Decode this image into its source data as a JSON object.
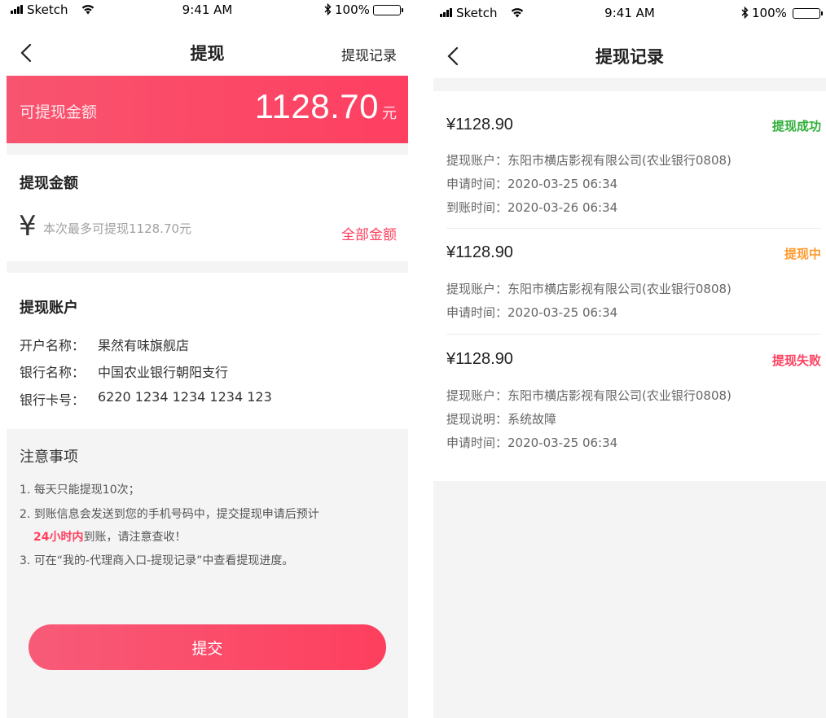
{
  "status_bar": {
    "carrier": "Sketch",
    "time": "9:41 AM",
    "battery": "100%"
  },
  "withdraw_page": {
    "title": "提现",
    "records_link": "提现记录",
    "balance_label": "可提现金额",
    "balance_amount": "1128.70",
    "balance_unit": "元",
    "amount_section_title": "提现金额",
    "currency_symbol": "¥",
    "amount_placeholder": "本次最多可提现1128.70元",
    "all_amount_label": "全部金额",
    "account_section_title": "提现账户",
    "account_rows": [
      {
        "key": "开户名称：",
        "value": "果然有味旗舰店"
      },
      {
        "key": "银行名称：",
        "value": "中国农业银行朝阳支行"
      },
      {
        "key": "银行卡号：",
        "value": "6220 1234 1234 1234 123"
      }
    ],
    "notice_title": "注意事项",
    "notice_1": "1. 每天只能提现10次；",
    "notice_2": "2. 到账信息会发送到您的手机号码中，提交提现申请后预计",
    "notice_2b_highlight": "24小时内",
    "notice_2b_rest": "到账，请注意查收！",
    "notice_3": "3. 可在“我的-代理商入口-提现记录”中查看提现进度。",
    "submit_label": "提交"
  },
  "records_page": {
    "title": "提现记录",
    "records": [
      {
        "amount": "¥1128.90",
        "status": "提现成功",
        "status_color": "#2eae38",
        "account": "提现账户：东阳市横店影视有限公司(农业银行0808)",
        "apply_time": "申请时间：2020-03-25  06:34",
        "arrive_time": "到账时间：2020-03-26  06:34"
      },
      {
        "amount": "¥1128.90",
        "status": "提现中",
        "status_color": "#ff9a2e",
        "account": "提现账户：东阳市横店影视有限公司(农业银行0808)",
        "apply_time": "申请时间：2020-03-25  06:34"
      },
      {
        "amount": "¥1128.90",
        "status": "提现失败",
        "status_color": "#fe3f5e",
        "account": "提现账户：东阳市横店影视有限公司(农业银行0808)",
        "fail_reason": "提现说明：系统故障",
        "apply_time": "申请时间：2020-03-25  06:34"
      }
    ]
  },
  "icons": {
    "signal": "signal-bars-icon",
    "wifi": "wifi-icon",
    "bluetooth": "bluetooth-icon",
    "battery": "battery-icon",
    "back": "chevron-left-icon"
  },
  "colors": {
    "accent": "#fe3f5e",
    "banner_start": "#f8546f",
    "success": "#2eae38",
    "pending": "#ff9a2e",
    "page_gray": "#f4f4f4"
  }
}
